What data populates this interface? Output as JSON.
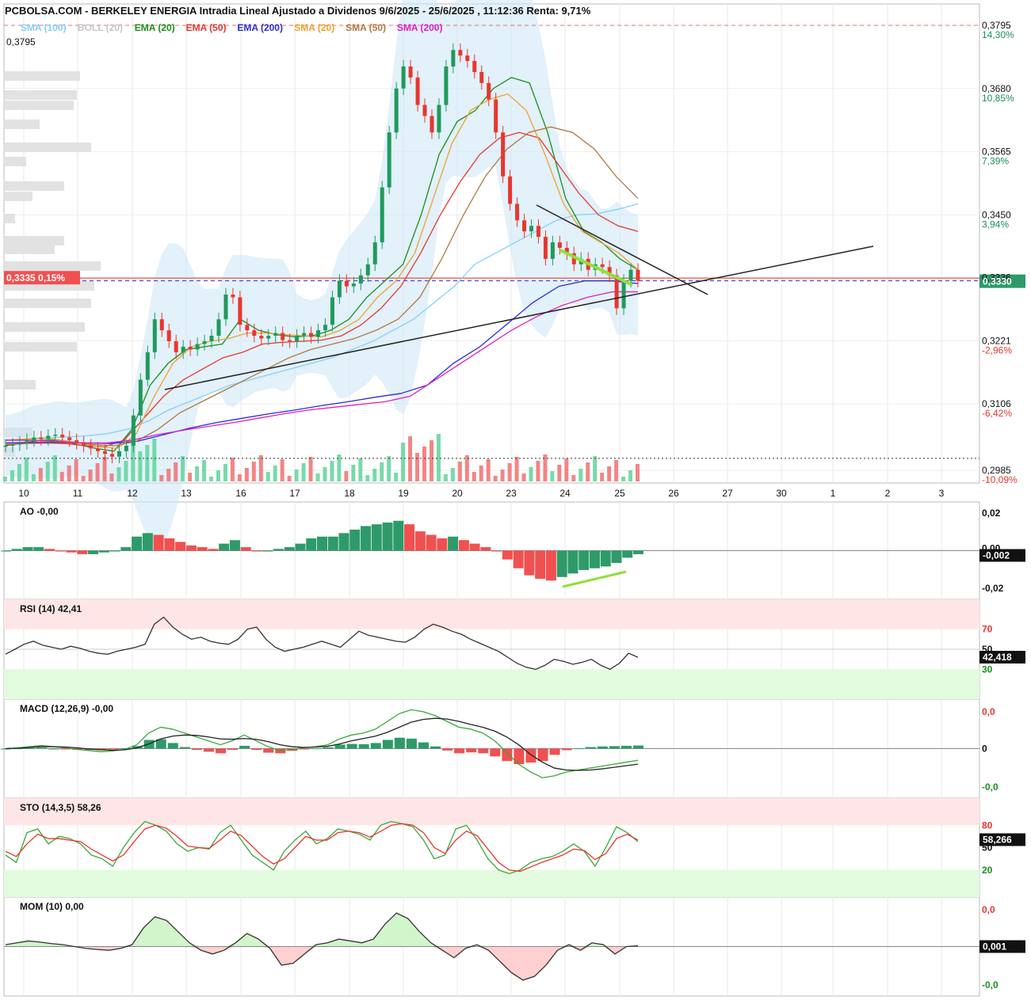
{
  "title": "PCBOLSA.COM - BERKELEY ENERGIA Intradia Lineal Ajustado a Dividenos 9/6/2025 - 25/6/2025 , 11:12:36 Renta: 9,71%",
  "indicators": [
    {
      "label": "SMA (100)",
      "color": "#87cefa"
    },
    {
      "label": "BOLL (20)",
      "color": "#c8c8c8"
    },
    {
      "label": "EMA (20)",
      "color": "#1a8f1a"
    },
    {
      "label": "EMA (50)",
      "color": "#e8362f"
    },
    {
      "label": "EMA (200)",
      "color": "#2b2be0"
    },
    {
      "label": "SMA (20)",
      "color": "#f0a030"
    },
    {
      "label": "SMA (50)",
      "color": "#b07840"
    },
    {
      "label": "SMA (200)",
      "color": "#e020c0"
    }
  ],
  "price_badge": "0,3335 0,15%",
  "last_price_tag": "0,3330",
  "max_label": "0,3795",
  "chart_data": [
    {
      "type": "line",
      "name": "price",
      "x_ticks": [
        "10",
        "11",
        "12",
        "13",
        "16",
        "17",
        "18",
        "19",
        "20",
        "23",
        "24",
        "25",
        "26",
        "27",
        "30",
        "1",
        "2",
        "3"
      ],
      "y_ticks": [
        {
          "value": "0,3795",
          "pct": "14,30%"
        },
        {
          "value": "0,3680",
          "pct": "10,85%"
        },
        {
          "value": "0,3565",
          "pct": "7,39%"
        },
        {
          "value": "0,3450",
          "pct": "3,94%"
        },
        {
          "value": "0,3336",
          "pct": ""
        },
        {
          "value": "0,3221",
          "pct": "-2,96%"
        },
        {
          "value": "0,3106",
          "pct": "-6,42%"
        },
        {
          "value": "0,2985",
          "pct": "-10,09%"
        }
      ],
      "ylim": [
        0.2965,
        0.3805
      ],
      "close_series": [
        0.303,
        0.3032,
        0.3035,
        0.304,
        0.3045,
        0.3042,
        0.3048,
        0.305,
        0.3045,
        0.304,
        0.3035,
        0.303,
        0.3025,
        0.302,
        0.3015,
        0.301,
        0.302,
        0.303,
        0.3085,
        0.315,
        0.32,
        0.326,
        0.324,
        0.322,
        0.32,
        0.321,
        0.3205,
        0.3215,
        0.322,
        0.323,
        0.326,
        0.3305,
        0.33,
        0.325,
        0.324,
        0.323,
        0.3225,
        0.323,
        0.3235,
        0.3222,
        0.322,
        0.323,
        0.3235,
        0.3228,
        0.324,
        0.325,
        0.33,
        0.333,
        0.332,
        0.3325,
        0.334,
        0.336,
        0.34,
        0.35,
        0.36,
        0.368,
        0.372,
        0.37,
        0.365,
        0.363,
        0.36,
        0.365,
        0.372,
        0.375,
        0.374,
        0.373,
        0.371,
        0.369,
        0.366,
        0.36,
        0.352,
        0.347,
        0.344,
        0.342,
        0.343,
        0.341,
        0.337,
        0.34,
        0.339,
        0.338,
        0.336,
        0.337,
        0.335,
        0.336,
        0.3355,
        0.334,
        0.328,
        0.333,
        0.335,
        0.333
      ],
      "overlays": [
        {
          "name": "SMA (100)",
          "color": "#87cefa",
          "values": [
            0.304,
            0.3042,
            0.3044,
            0.3046,
            0.3048,
            0.3052,
            0.306,
            0.3075,
            0.3095,
            0.311,
            0.3125,
            0.314,
            0.315,
            0.316,
            0.317,
            0.318,
            0.319,
            0.3205,
            0.322,
            0.324,
            0.326,
            0.329,
            0.332,
            0.336,
            0.338,
            0.34,
            0.342,
            0.344,
            0.345,
            0.3452,
            0.346,
            0.347
          ]
        },
        {
          "name": "EMA (20)",
          "color": "#1a8f1a",
          "values": [
            0.303,
            0.3035,
            0.304,
            0.304,
            0.3032,
            0.3025,
            0.302,
            0.306,
            0.314,
            0.318,
            0.3205,
            0.321,
            0.3215,
            0.326,
            0.324,
            0.3232,
            0.3228,
            0.323,
            0.324,
            0.326,
            0.33,
            0.333,
            0.336,
            0.345,
            0.356,
            0.362,
            0.364,
            0.368,
            0.37,
            0.369,
            0.36,
            0.348,
            0.342,
            0.34,
            0.337,
            0.335
          ]
        },
        {
          "name": "EMA (50)",
          "color": "#e8362f",
          "values": [
            0.3032,
            0.3034,
            0.3035,
            0.3034,
            0.303,
            0.3028,
            0.304,
            0.308,
            0.312,
            0.315,
            0.317,
            0.319,
            0.32,
            0.3215,
            0.3218,
            0.322,
            0.3222,
            0.323,
            0.325,
            0.328,
            0.332,
            0.338,
            0.345,
            0.351,
            0.356,
            0.359,
            0.36,
            0.359,
            0.354,
            0.349,
            0.345,
            0.343,
            0.342
          ]
        },
        {
          "name": "EMA (200)",
          "color": "#2b2be0",
          "values": [
            0.3035,
            0.3036,
            0.3036,
            0.3035,
            0.3034,
            0.3038,
            0.305,
            0.3062,
            0.3072,
            0.308,
            0.3088,
            0.3095,
            0.3103,
            0.311,
            0.3118,
            0.3125,
            0.314,
            0.318,
            0.321,
            0.325,
            0.329,
            0.332,
            0.333,
            0.333,
            0.3325
          ]
        },
        {
          "name": "SMA (20)",
          "color": "#f0a030",
          "values": [
            0.304,
            0.3042,
            0.3044,
            0.304,
            0.3035,
            0.3028,
            0.3025,
            0.305,
            0.312,
            0.318,
            0.321,
            0.322,
            0.3225,
            0.3235,
            0.3235,
            0.3232,
            0.323,
            0.3228,
            0.324,
            0.326,
            0.33,
            0.333,
            0.338,
            0.348,
            0.358,
            0.364,
            0.366,
            0.367,
            0.364,
            0.356,
            0.347,
            0.342,
            0.34,
            0.338,
            0.335
          ]
        },
        {
          "name": "SMA (50)",
          "color": "#b07840",
          "values": [
            0.304,
            0.304,
            0.3038,
            0.3036,
            0.3032,
            0.303,
            0.3038,
            0.306,
            0.309,
            0.311,
            0.313,
            0.315,
            0.317,
            0.319,
            0.3205,
            0.3215,
            0.3225,
            0.324,
            0.326,
            0.33,
            0.337,
            0.345,
            0.352,
            0.357,
            0.36,
            0.361,
            0.36,
            0.357,
            0.352,
            0.348
          ]
        },
        {
          "name": "SMA (200)",
          "color": "#e020c0",
          "values": [
            0.304,
            0.304,
            0.3038,
            0.3035,
            0.3035,
            0.304,
            0.305,
            0.3058,
            0.3065,
            0.3072,
            0.308,
            0.3088,
            0.3095,
            0.31,
            0.3105,
            0.311,
            0.312,
            0.315,
            0.318,
            0.321,
            0.324,
            0.3265,
            0.3285,
            0.33,
            0.331,
            0.331
          ]
        }
      ],
      "reference_lines": [
        {
          "value": 0.3795,
          "color": "#e87070",
          "style": "dashed"
        },
        {
          "value": 0.3335,
          "color": "#e8362f",
          "style": "solid"
        },
        {
          "value": 0.333,
          "color": "#2b2be0",
          "style": "dashed"
        },
        {
          "value": 0.3007,
          "color": "#333333",
          "style": "dotted"
        }
      ]
    },
    {
      "type": "bar",
      "name": "AO -0,00",
      "y_ticks": [
        "0,02",
        "0,00",
        "-0,02"
      ],
      "last_tag": "-0,002",
      "ylim": [
        -0.025,
        0.025
      ],
      "values": [
        0.0,
        0.001,
        0.002,
        0.002,
        0.001,
        0.0,
        -0.001,
        -0.002,
        -0.002,
        -0.001,
        0.0,
        0.002,
        0.008,
        0.01,
        0.009,
        0.007,
        0.005,
        0.003,
        0.002,
        0.001,
        0.004,
        0.006,
        0.002,
        0.0,
        0.0,
        0.001,
        0.002,
        0.004,
        0.007,
        0.008,
        0.008,
        0.01,
        0.012,
        0.014,
        0.015,
        0.016,
        0.017,
        0.015,
        0.011,
        0.009,
        0.007,
        0.008,
        0.006,
        0.004,
        0.002,
        0.0,
        -0.005,
        -0.01,
        -0.014,
        -0.016,
        -0.017,
        -0.015,
        -0.013,
        -0.011,
        -0.01,
        -0.009,
        -0.007,
        -0.004,
        -0.002
      ]
    },
    {
      "type": "line",
      "name": "RSI (14) 42,41",
      "y_ticks": [
        "70",
        "50",
        "30"
      ],
      "last_tag": "42,418",
      "ylim": [
        5,
        95
      ],
      "values": [
        45,
        50,
        55,
        58,
        54,
        52,
        50,
        53,
        51,
        48,
        46,
        45,
        48,
        50,
        52,
        55,
        75,
        82,
        72,
        65,
        60,
        62,
        58,
        56,
        55,
        60,
        70,
        72,
        60,
        52,
        48,
        50,
        52,
        55,
        58,
        55,
        52,
        60,
        68,
        64,
        62,
        60,
        58,
        57,
        62,
        70,
        75,
        72,
        68,
        65,
        60,
        56,
        52,
        48,
        42,
        36,
        32,
        30,
        34,
        40,
        38,
        35,
        37,
        40,
        34,
        30,
        36,
        46,
        42
      ]
    },
    {
      "type": "line",
      "name": "MACD (12,26,9) -0,00",
      "y_ticks": [
        "0,0",
        "0",
        "-0,0"
      ],
      "ylim": [
        -1.15,
        1.15
      ],
      "macd": [
        0.0,
        0.02,
        0.05,
        0.08,
        0.05,
        0.02,
        -0.02,
        -0.05,
        -0.08,
        -0.06,
        -0.02,
        0.1,
        0.4,
        0.55,
        0.5,
        0.4,
        0.3,
        0.2,
        0.1,
        0.2,
        0.35,
        0.2,
        0.05,
        -0.05,
        -0.02,
        0.02,
        0.05,
        0.1,
        0.25,
        0.35,
        0.4,
        0.5,
        0.7,
        0.9,
        1.0,
        0.95,
        0.85,
        0.7,
        0.55,
        0.5,
        0.4,
        0.2,
        -0.1,
        -0.4,
        -0.6,
        -0.75,
        -0.7,
        -0.6,
        -0.55,
        -0.5,
        -0.45,
        -0.4,
        -0.35,
        -0.3
      ],
      "signal": [
        0.0,
        0.01,
        0.03,
        0.05,
        0.05,
        0.04,
        0.02,
        -0.01,
        -0.03,
        -0.04,
        -0.03,
        0.02,
        0.12,
        0.25,
        0.32,
        0.35,
        0.34,
        0.3,
        0.25,
        0.24,
        0.26,
        0.24,
        0.18,
        0.1,
        0.05,
        0.03,
        0.04,
        0.06,
        0.12,
        0.2,
        0.26,
        0.32,
        0.42,
        0.55,
        0.68,
        0.75,
        0.78,
        0.76,
        0.7,
        0.62,
        0.55,
        0.45,
        0.3,
        0.1,
        -0.15,
        -0.35,
        -0.5,
        -0.55,
        -0.56,
        -0.55,
        -0.52,
        -0.48,
        -0.44,
        -0.4
      ]
    },
    {
      "type": "line",
      "name": "STO (14,3,5) 58,26",
      "y_ticks": [
        "80",
        "50",
        "20"
      ],
      "last_tag": "58,266",
      "ylim": [
        -10,
        110
      ],
      "k": [
        40,
        30,
        70,
        75,
        55,
        65,
        62,
        55,
        40,
        35,
        25,
        50,
        70,
        85,
        80,
        72,
        55,
        45,
        50,
        48,
        70,
        80,
        60,
        40,
        30,
        20,
        45,
        60,
        72,
        55,
        62,
        75,
        72,
        68,
        60,
        80,
        85,
        82,
        78,
        60,
        35,
        40,
        75,
        80,
        60,
        35,
        20,
        15,
        20,
        30,
        35,
        38,
        45,
        55,
        45,
        25,
        50,
        78,
        70,
        58
      ],
      "d": [
        45,
        38,
        55,
        68,
        62,
        62,
        60,
        58,
        48,
        40,
        32,
        40,
        58,
        75,
        80,
        76,
        65,
        52,
        50,
        49,
        60,
        72,
        66,
        52,
        38,
        28,
        35,
        50,
        65,
        60,
        60,
        70,
        72,
        70,
        64,
        72,
        80,
        82,
        80,
        70,
        50,
        42,
        60,
        72,
        66,
        48,
        30,
        20,
        18,
        24,
        30,
        35,
        40,
        48,
        46,
        34,
        42,
        62,
        68,
        60
      ]
    },
    {
      "type": "area",
      "name": "MOM (10) 0,00",
      "y_ticks": [
        "0,0",
        "0,001",
        "-0,0"
      ],
      "last_tag": "0,001",
      "ylim": [
        -1.2,
        1.2
      ],
      "values": [
        0.05,
        0.1,
        0.15,
        0.12,
        0.08,
        0.05,
        0.0,
        -0.05,
        -0.08,
        -0.1,
        -0.05,
        0.05,
        0.5,
        0.8,
        0.7,
        0.4,
        0.1,
        -0.1,
        -0.2,
        -0.1,
        0.1,
        0.35,
        0.2,
        -0.05,
        -0.5,
        -0.45,
        -0.2,
        0.05,
        0.1,
        0.2,
        0.15,
        0.1,
        0.2,
        0.6,
        0.9,
        0.75,
        0.4,
        0.1,
        -0.1,
        -0.3,
        -0.05,
        0.05,
        -0.1,
        -0.4,
        -0.7,
        -0.9,
        -0.8,
        -0.5,
        -0.1,
        0.05,
        -0.1,
        0.1,
        0.05,
        -0.2,
        0.0,
        0.02
      ]
    }
  ]
}
